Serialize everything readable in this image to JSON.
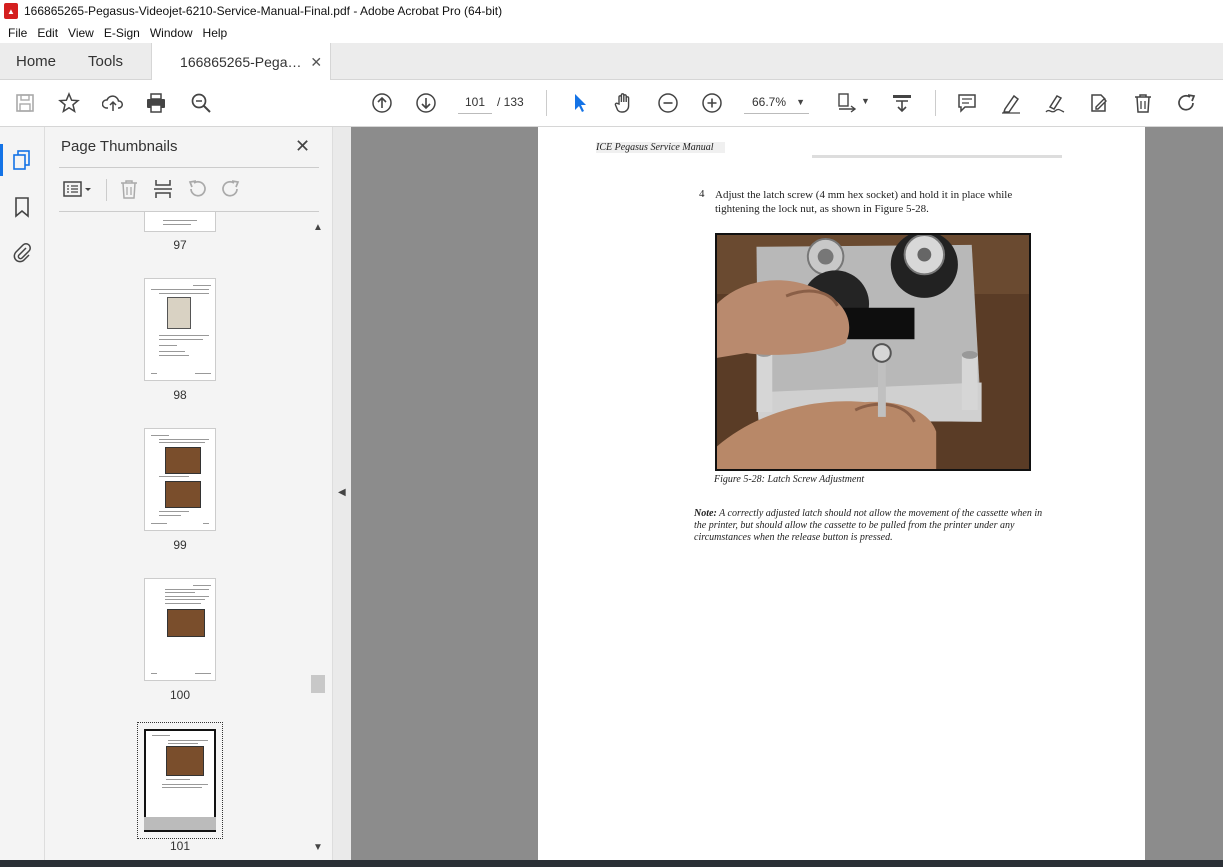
{
  "window": {
    "title": "166865265-Pegasus-Videojet-6210-Service-Manual-Final.pdf - Adobe Acrobat Pro (64-bit)",
    "icon": "pdf-icon"
  },
  "menu": [
    "File",
    "Edit",
    "View",
    "E-Sign",
    "Window",
    "Help"
  ],
  "tabs": {
    "home": "Home",
    "tools": "Tools",
    "document": "166865265-Pegas..."
  },
  "toolbar": {
    "icons": [
      "save-icon",
      "star-icon",
      "upload-icon",
      "print-icon",
      "zoom-search-icon",
      "page-up-icon",
      "page-down-icon",
      "select-cursor-icon",
      "hand-icon",
      "zoom-out-icon",
      "zoom-in-icon",
      "fit-page-icon",
      "scroll-mode-icon",
      "comment-icon",
      "highlight-icon",
      "sign-icon",
      "edit-pdf-icon",
      "delete-icon",
      "redo-icon"
    ],
    "current_page": "101",
    "page_total": "/  133",
    "zoom": "66.7%"
  },
  "left_rail": [
    "page-thumbnails-icon",
    "bookmark-icon",
    "attachment-icon"
  ],
  "panel": {
    "title": "Page Thumbnails",
    "thumbnails": [
      {
        "label": "97"
      },
      {
        "label": "98"
      },
      {
        "label": "99"
      },
      {
        "label": "100"
      },
      {
        "label": "101",
        "selected": true
      }
    ]
  },
  "document": {
    "header": "ICE Pegasus Service Manual",
    "step_number": "4",
    "step_text": "Adjust the latch screw (4 mm hex socket) and hold it in place while tightening the lock nut, as shown in Figure 5-28.",
    "figure_caption": "Figure 5-28: Latch Screw Adjustment",
    "note_label": "Note:",
    "note_text": " A correctly adjusted latch should not allow the movement of the cassette when in the printer, but should allow the cassette to be pulled from the printer under any circumstances when the release button is pressed."
  }
}
